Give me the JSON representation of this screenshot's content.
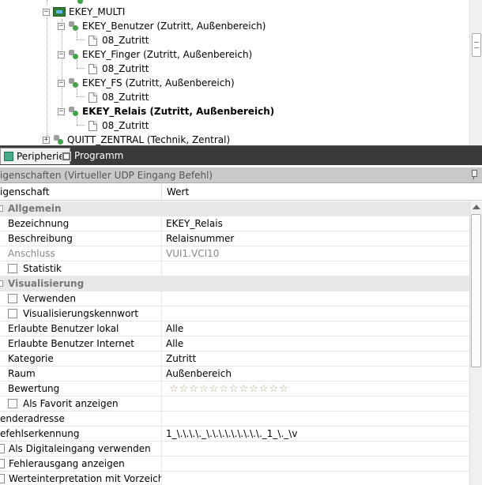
{
  "tree": {
    "nodes": [
      {
        "label": "EKEY_MULTI"
      },
      {
        "label": "EKEY_Benutzer (Zutritt, Außenbereich)"
      },
      {
        "label": "08_Zutritt"
      },
      {
        "label": "EKEY_Finger (Zutritt, Außenbereich)"
      },
      {
        "label": "08_Zutritt"
      },
      {
        "label": "EKEY_FS (Zutritt, Außenbereich)"
      },
      {
        "label": "08_Zutritt"
      },
      {
        "label": "EKEY_Relais (Zutritt, Außenbereich)"
      },
      {
        "label": "08_Zutritt"
      },
      {
        "label": "QUITT_ZENTRAL (Technik, Zentral)"
      }
    ]
  },
  "tabs": {
    "peripherie": "Peripherie",
    "programm": "Programm"
  },
  "properties": {
    "title": "igenschaften (Virtueller UDP Eingang Befehl)",
    "col_name": "igenschaft",
    "col_value": "Wert",
    "rows": [
      {
        "name": "Allgemein",
        "value": ""
      },
      {
        "name": "Bezeichnung",
        "value": "EKEY_Relais"
      },
      {
        "name": "Beschreibung",
        "value": "Relaisnummer"
      },
      {
        "name": "Anschluss",
        "value": "VUI1.VCI10"
      },
      {
        "name": "Statistik",
        "value": ""
      },
      {
        "name": "Visualisierung",
        "value": ""
      },
      {
        "name": "Verwenden",
        "value": ""
      },
      {
        "name": "Visualisierungskennwort",
        "value": ""
      },
      {
        "name": "Erlaubte Benutzer lokal",
        "value": "Alle"
      },
      {
        "name": "Erlaubte Benutzer Internet",
        "value": "Alle"
      },
      {
        "name": "Kategorie",
        "value": "Zutritt"
      },
      {
        "name": "Raum",
        "value": "Außenbereich"
      },
      {
        "name": "Bewertung",
        "value": "☆☆☆☆☆☆☆☆☆☆☆☆"
      },
      {
        "name": "Als Favorit anzeigen",
        "value": ""
      },
      {
        "name": "enderadresse",
        "value": ""
      },
      {
        "name": "efehlserkennung",
        "value": "1_\\.\\.\\.\\._\\.\\.\\.\\.\\.\\.\\.\\.\\._1_\\._\\v"
      },
      {
        "name": "Als Digitaleingang verwenden",
        "value": ""
      },
      {
        "name": "Fehlerausgang anzeigen",
        "value": ""
      },
      {
        "name": "Werteinterpretation mit Vorzeichen",
        "value": ""
      }
    ]
  }
}
